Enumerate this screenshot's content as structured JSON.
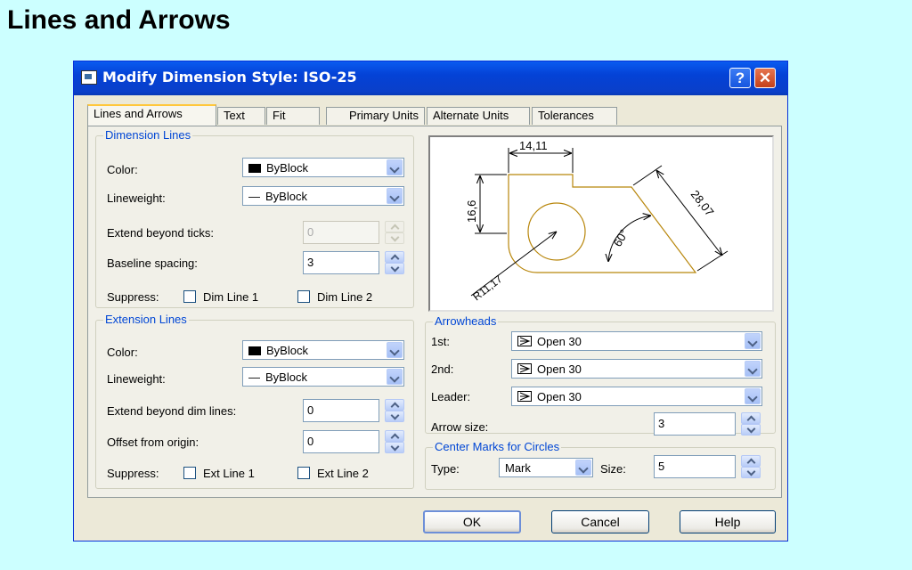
{
  "slide": {
    "title": "Lines and Arrows"
  },
  "dialog": {
    "title": "Modify Dimension Style: ISO-25",
    "help_glyph": "?",
    "close_glyph": "✕",
    "icon": "dialog-app-icon"
  },
  "tabs": [
    {
      "label": "Lines and Arrows",
      "active": true
    },
    {
      "label": "Text"
    },
    {
      "label": "Fit"
    },
    {
      "label": "Primary Units"
    },
    {
      "label": "Alternate Units"
    },
    {
      "label": "Tolerances"
    }
  ],
  "dimension_lines": {
    "legend": "Dimension Lines",
    "color_label": "Color:",
    "color_value": "ByBlock",
    "lineweight_label": "Lineweight:",
    "lineweight_value": "ByBlock",
    "extend_label": "Extend beyond ticks:",
    "extend_value": "0",
    "baseline_label": "Baseline spacing:",
    "baseline_value": "3",
    "suppress_label": "Suppress:",
    "suppress_1": "Dim Line 1",
    "suppress_2": "Dim Line 2"
  },
  "extension_lines": {
    "legend": "Extension Lines",
    "color_label": "Color:",
    "color_value": "ByBlock",
    "lineweight_label": "Lineweight:",
    "lineweight_value": "ByBlock",
    "extend_label": "Extend beyond dim lines:",
    "extend_value": "0",
    "offset_label": "Offset from origin:",
    "offset_value": "0",
    "suppress_label": "Suppress:",
    "suppress_1": "Ext Line 1",
    "suppress_2": "Ext Line 2"
  },
  "preview": {
    "dim_top": "14,11",
    "dim_left": "16,6",
    "dim_right": "28,07",
    "dim_angle": "60°",
    "dim_radius": "R11,17"
  },
  "arrowheads": {
    "legend": "Arrowheads",
    "first_label": "1st:",
    "first_value": "Open 30",
    "second_label": "2nd:",
    "second_value": "Open 30",
    "leader_label": "Leader:",
    "leader_value": "Open 30",
    "size_label": "Arrow size:",
    "size_value": "3"
  },
  "center_marks": {
    "legend": "Center Marks for Circles",
    "type_label": "Type:",
    "type_value": "Mark",
    "size_label": "Size:",
    "size_value": "5"
  },
  "buttons": {
    "ok": "OK",
    "cancel": "Cancel",
    "help": "Help"
  },
  "colors": {
    "titlebar": "#0a4bdf",
    "legend_text": "#0046d5",
    "active_tab_accent": "#ffc73c",
    "background": "#ccffff"
  }
}
